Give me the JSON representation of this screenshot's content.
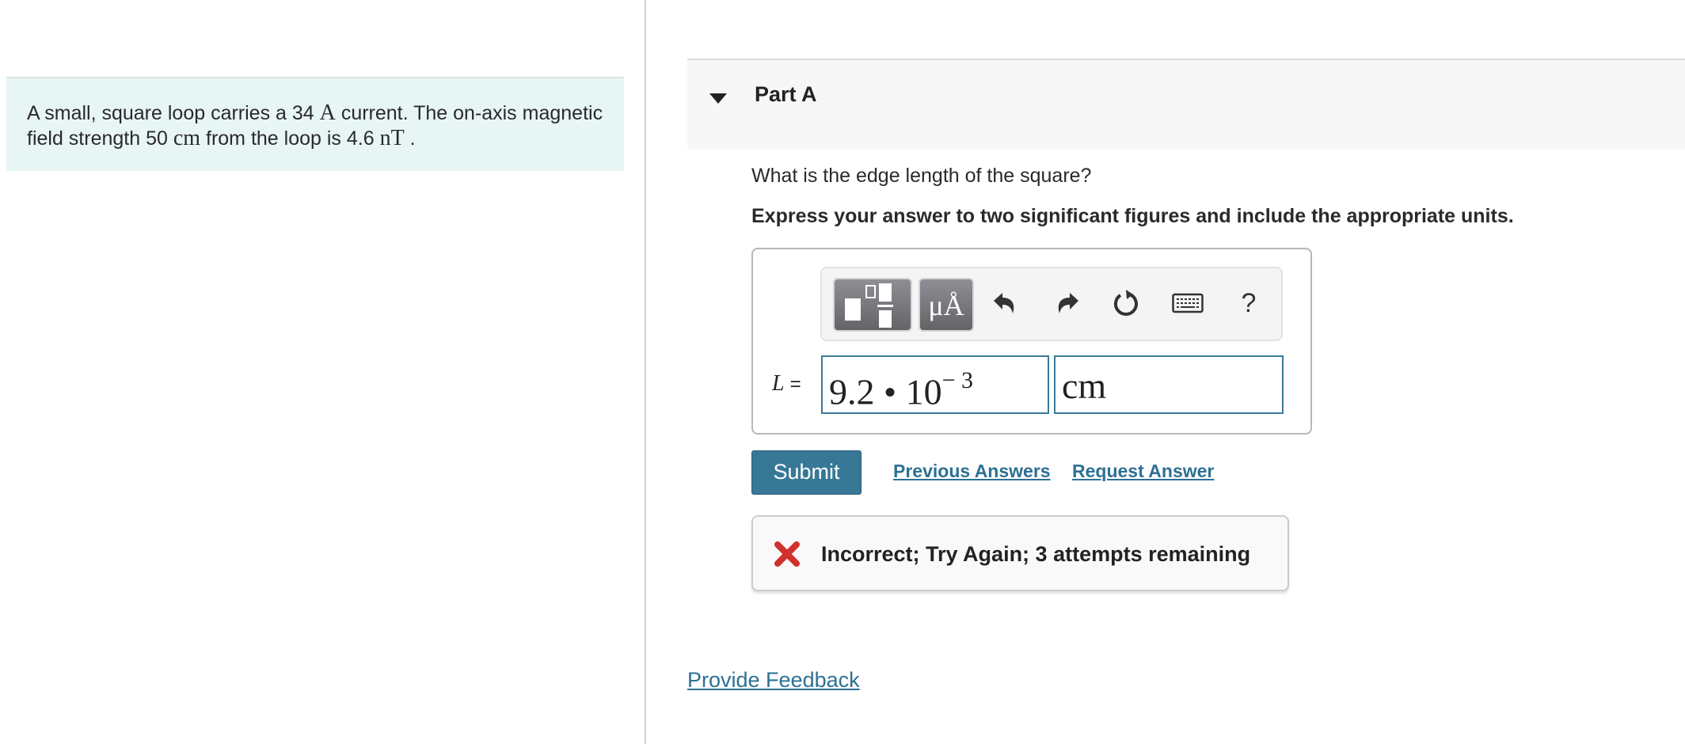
{
  "problem": {
    "text_parts": [
      "A small, square loop carries a 34 ",
      "A",
      " current. The on-axis magnetic field strength 50 ",
      "cm",
      " from the loop is 4.6 ",
      "nT",
      " ."
    ]
  },
  "part": {
    "title": "Part A",
    "question": "What is the edge length of the square?",
    "instruction": "Express your answer to two significant figures and include the appropriate units."
  },
  "toolbar": {
    "templates_icon": "templates-icon",
    "units_label": "μÅ",
    "undo_icon": "undo-icon",
    "redo_icon": "redo-icon",
    "reset_icon": "reset-icon",
    "keyboard_icon": "keyboard-icon",
    "help_label": "?"
  },
  "answer": {
    "variable": "L",
    "equals": "=",
    "value_mantissa": "9.2 • 10",
    "value_exponent": "− 3",
    "unit": "cm"
  },
  "actions": {
    "submit_label": "Submit",
    "previous_answers_label": "Previous Answers",
    "request_answer_label": "Request Answer"
  },
  "feedback": {
    "status": "incorrect",
    "message": "Incorrect; Try Again; 3 attempts remaining",
    "icon_color": "#d0312d"
  },
  "footer": {
    "provide_feedback_label": "Provide Feedback"
  },
  "colors": {
    "link": "#2d7094",
    "submit_bg": "#367896",
    "problem_bg": "#e8f5f5",
    "input_border": "#3b7a99"
  }
}
